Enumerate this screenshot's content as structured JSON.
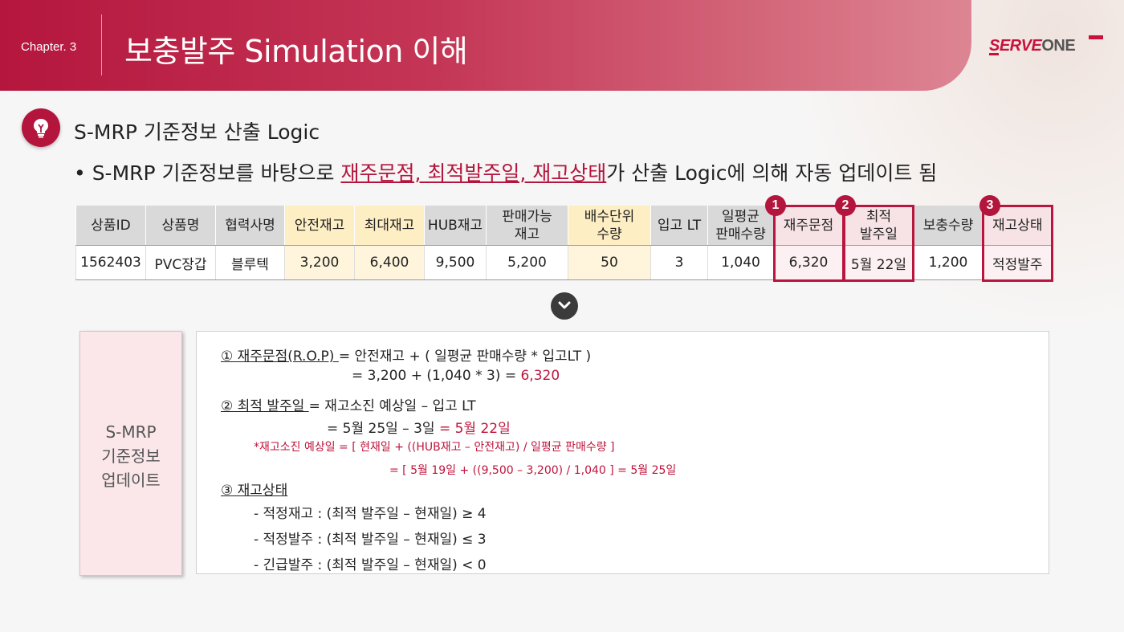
{
  "header": {
    "chapter": "Chapter. 3",
    "title": "보충발주 Simulation 이해",
    "logo_part1": "SERVE",
    "logo_part2": "ONE"
  },
  "section": {
    "icon": "lightbulb-icon",
    "title": "S-MRP 기준정보 산출 Logic",
    "bullet_prefix": "• S-MRP 기준정보를 바탕으로 ",
    "bullet_highlight": "재주문점, 최적발주일, 재고상태",
    "bullet_suffix": "가 산출 Logic에 의해 자동 업데이트 됨"
  },
  "table": {
    "headers": [
      "상품ID",
      "상품명",
      "협력사명",
      "안전재고",
      "최대재고",
      "HUB재고",
      "판매가능\n재고",
      "배수단위\n수량",
      "입고 LT",
      "일평균\n판매수량",
      "재주문점",
      "최적\n발주일",
      "보충수량",
      "재고상태"
    ],
    "row": [
      "1562403",
      "PVC장갑",
      "블루텍",
      "3,200",
      "6,400",
      "9,500",
      "5,200",
      "50",
      "3",
      "1,040",
      "6,320",
      "5월 22일",
      "1,200",
      "적정발주"
    ],
    "markers": [
      "1",
      "2",
      "3"
    ]
  },
  "colors": {
    "accent": "#b3153c",
    "header_gray": "#d9d9d9",
    "highlight_yellow": "#fdeec4",
    "highlight_pink": "#f7e3e6"
  },
  "update_box": {
    "label_lines": [
      "S-MRP",
      "기준정보",
      "업데이트"
    ]
  },
  "formulas": {
    "f1_label": "① 재주문점(R.O.P) ",
    "f1_expr": "= 안전재고 + ( 일평균 판매수량 * 입고LT )",
    "f1_calc": "=  3,200  +  (1,040 * 3)  = ",
    "f1_result": "6,320",
    "f2_label": "② 최적 발주일 ",
    "f2_expr": "= 재고소진 예상일 – 입고 LT",
    "f2_calc": "= 5월 25일 – 3일 ",
    "f2_result": "= 5월 22일",
    "f2_note1": "*재고소진 예상일 = [ 현재일 + ((HUB재고 – 안전재고) / 일평균 판매수량 ]",
    "f2_note2": "= [ 5월 19일  +  ((9,500 – 3,200) / 1,040 ]   = 5월 25일",
    "f3_label": "③ 재고상태",
    "f3_line1": "- 적정재고 : (최적 발주일 – 현재일)   ≥   4",
    "f3_line2": "- 적정발주 : (최적 발주일 – 현재일)   ≤   3",
    "f3_line3": "- 긴급발주 : (최적 발주일 –  현재일)  <   0"
  }
}
